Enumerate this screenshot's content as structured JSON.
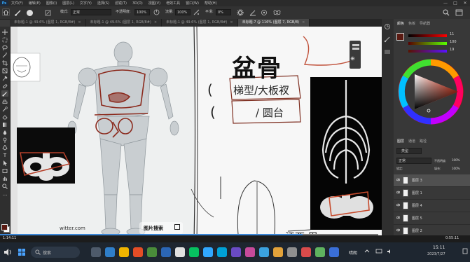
{
  "menubar": {
    "logo": "Ps",
    "items": [
      "文件(F)",
      "编辑(E)",
      "图像(I)",
      "图层(L)",
      "文字(Y)",
      "选择(S)",
      "滤镜(T)",
      "3D(D)",
      "视图(V)",
      "增效工具",
      "窗口(W)",
      "帮助(H)"
    ],
    "window_controls": [
      "—",
      "□",
      "✕"
    ]
  },
  "options": {
    "mode_label": "模式:",
    "mode_value": "正常",
    "opacity_label": "不透明度:",
    "opacity_value": "100%",
    "flow_label": "流量:",
    "flow_value": "100%",
    "smooth_label": "平滑:",
    "smooth_value": "0%"
  },
  "tabs": [
    {
      "label": "未标题-1 @ 49.6% (图层 1, RGB/8#)",
      "active": false
    },
    {
      "label": "未标题-1 @ 49.6% (图层 1, RGB/8#)",
      "active": false
    },
    {
      "label": "未标题-1 @ 49.6% (图层 1, RGB/8#)",
      "active": false
    },
    {
      "label": "未标题-7 @ 116% (图层 7, RGB/8)",
      "active": true
    }
  ],
  "canvas": {
    "heading": "盆骨",
    "sub1_open": "(",
    "sub1": "梯型/大板衩",
    "sub2_open": "(",
    "sub2": "/ 圆台",
    "bottom_text": "江西 周",
    "watermark": "witter.com",
    "image_search": "图片搜索",
    "ref_panel_icon": "⊕"
  },
  "right_panel": {
    "color_tabs": [
      "颜色",
      "色板",
      "导航器"
    ],
    "slider_values": [
      "11",
      "100",
      "19"
    ],
    "layers_tabs": [
      "图层",
      "通道",
      "路径"
    ],
    "filter_label": "类型",
    "blend_mode": "正常",
    "opacity_label": "不透明度:",
    "opacity_value": "100%",
    "lock_label": "锁定:",
    "fill_label": "填充:",
    "fill_value": "100%",
    "layers": [
      "图层 3",
      "图层 1",
      "图层 4",
      "图层 5",
      "图层 2"
    ]
  },
  "video": {
    "time_current": "1:14:11",
    "time_total": "0:55:11",
    "progress": 0.8
  },
  "taskbar": {
    "search_placeholder": "搜索",
    "weather": "晴朗",
    "time": "15:11",
    "date": "2023/7/27"
  }
}
